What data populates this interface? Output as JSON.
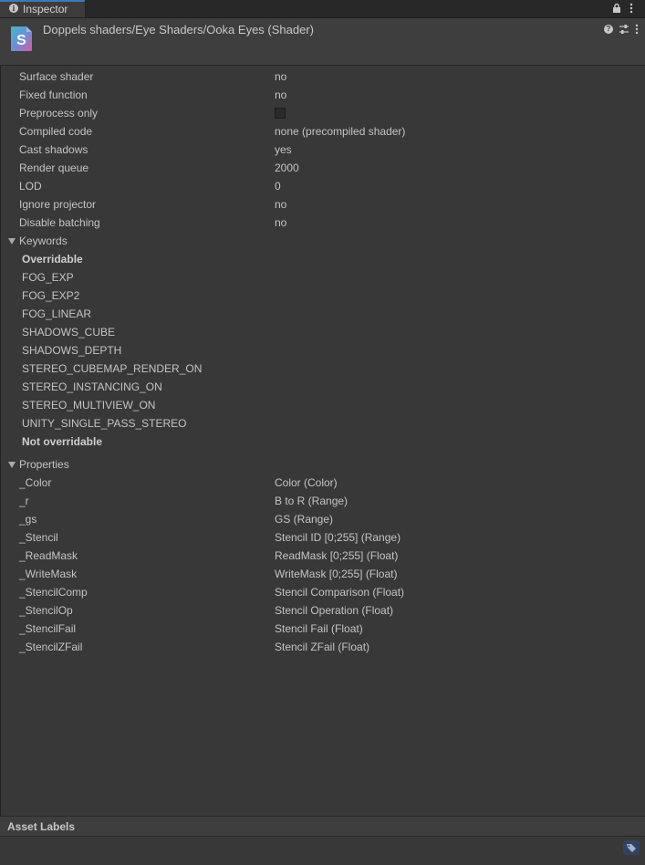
{
  "tab": {
    "label": "Inspector"
  },
  "header": {
    "title": "Doppels shaders/Eye Shaders/Ooka Eyes (Shader)",
    "icon_letter": "S"
  },
  "info_rows": [
    {
      "label": "Surface shader",
      "value": "no"
    },
    {
      "label": "Fixed function",
      "value": "no"
    },
    {
      "label": "Preprocess only",
      "value": ""
    },
    {
      "label": "Compiled code",
      "value": "none (precompiled shader)"
    },
    {
      "label": "Cast shadows",
      "value": "yes"
    },
    {
      "label": "Render queue",
      "value": "2000"
    },
    {
      "label": "LOD",
      "value": "0"
    },
    {
      "label": "Ignore projector",
      "value": "no"
    },
    {
      "label": "Disable batching",
      "value": "no"
    }
  ],
  "keywords": {
    "heading": "Keywords",
    "overridable_label": "Overridable",
    "overridable": [
      "FOG_EXP",
      "FOG_EXP2",
      "FOG_LINEAR",
      "SHADOWS_CUBE",
      "SHADOWS_DEPTH",
      "STEREO_CUBEMAP_RENDER_ON",
      "STEREO_INSTANCING_ON",
      "STEREO_MULTIVIEW_ON",
      "UNITY_SINGLE_PASS_STEREO"
    ],
    "not_overridable_label": "Not overridable"
  },
  "properties": {
    "heading": "Properties",
    "items": [
      {
        "name": "_Color",
        "desc": "Color (Color)"
      },
      {
        "name": "_r",
        "desc": "B to R (Range)"
      },
      {
        "name": "_gs",
        "desc": "GS (Range)"
      },
      {
        "name": "_Stencil",
        "desc": "Stencil ID [0;255] (Range)"
      },
      {
        "name": "_ReadMask",
        "desc": "ReadMask [0;255] (Float)"
      },
      {
        "name": "_WriteMask",
        "desc": "WriteMask [0;255] (Float)"
      },
      {
        "name": "_StencilComp",
        "desc": "Stencil Comparison (Float)"
      },
      {
        "name": "_StencilOp",
        "desc": "Stencil Operation (Float)"
      },
      {
        "name": "_StencilFail",
        "desc": "Stencil Fail (Float)"
      },
      {
        "name": "_StencilZFail",
        "desc": "Stencil ZFail (Float)"
      }
    ]
  },
  "footer": {
    "title": "Asset Labels"
  }
}
